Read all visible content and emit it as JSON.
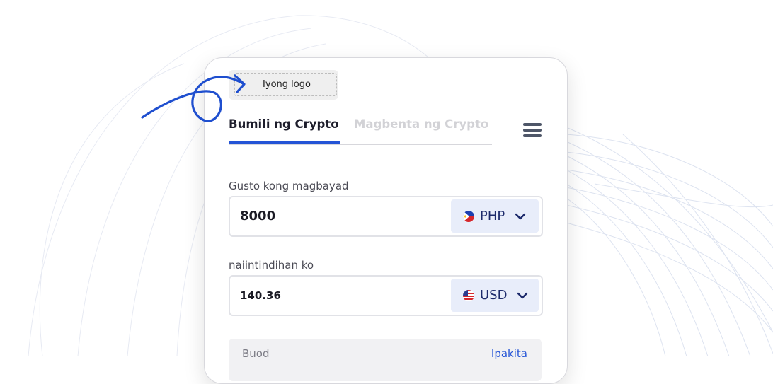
{
  "logo": {
    "placeholder_text": "Iyong logo"
  },
  "tabs": {
    "buy_label": "Bumili ng Crypto",
    "sell_label": "Magbenta ng Crypto",
    "active": "buy"
  },
  "pay_field": {
    "label": "Gusto kong magbayad",
    "value": "8000",
    "currency": "PHP",
    "flag_icon": "philippines-flag-icon"
  },
  "receive_field": {
    "label": "naiintindihan ko",
    "value": "140.36",
    "currency": "USD",
    "flag_icon": "usa-flag-icon"
  },
  "summary": {
    "title": "Buod",
    "toggle_label": "Ipakita"
  },
  "menu": {
    "icon": "hamburger-menu-icon"
  },
  "colors": {
    "accent": "#2454d6",
    "currency_bg": "#e8edfa",
    "currency_text": "#1c2a6b",
    "arrow": "#1f4fcf"
  }
}
